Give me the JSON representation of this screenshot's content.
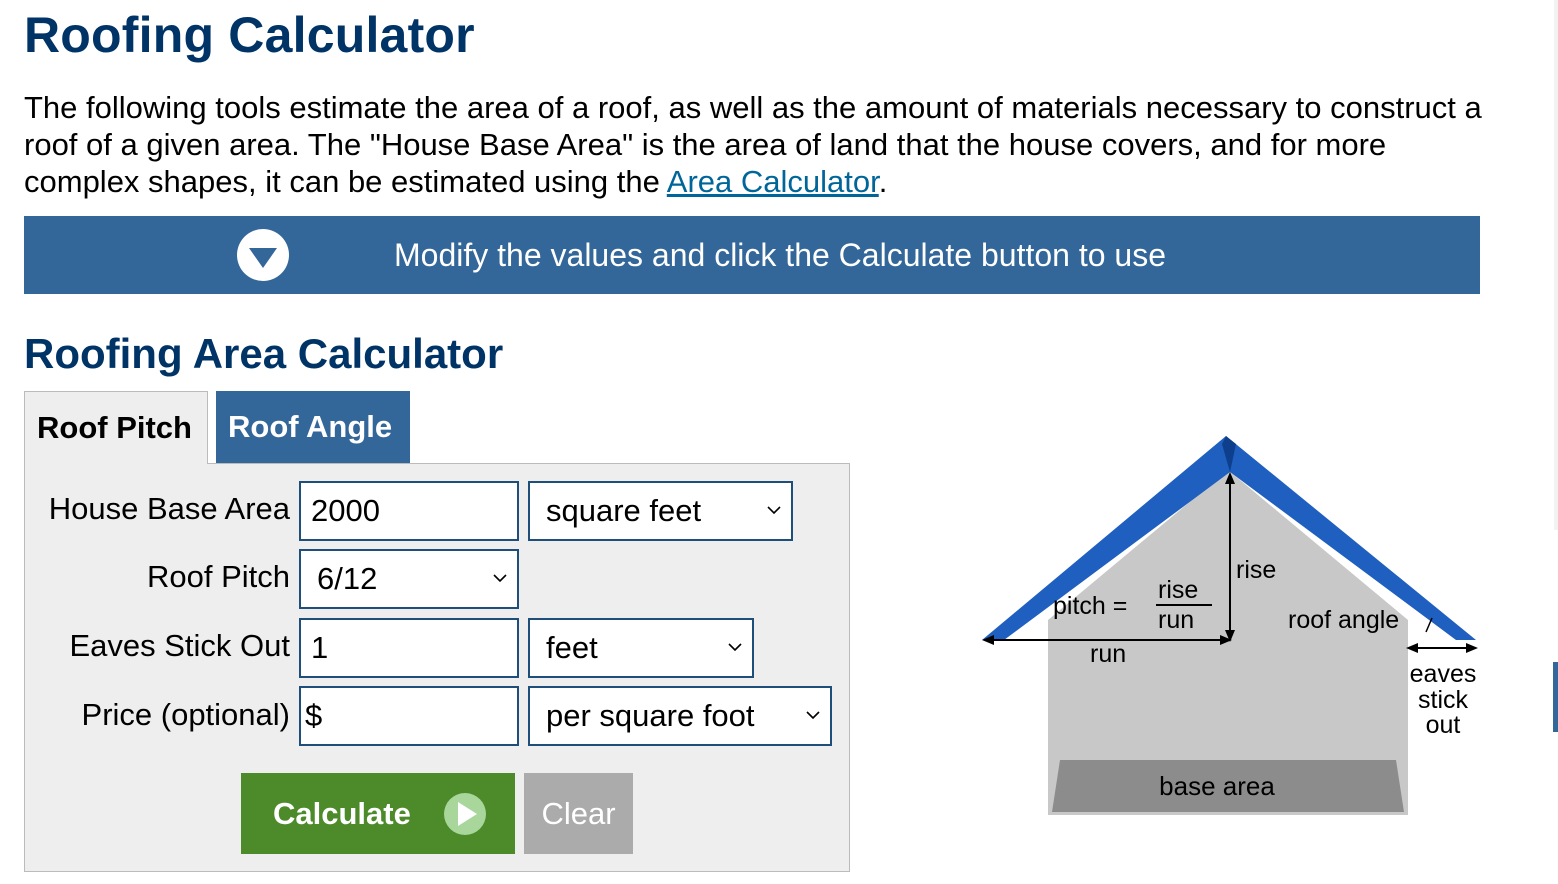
{
  "page": {
    "title": "Roofing Calculator",
    "intro_text": "The following tools estimate the area of a roof, as well as the amount of materials necessary to construct a roof of a given area. The \"House Base Area\" is the area of land that the house covers, and for more complex shapes, it can be estimated using the",
    "intro_link": "Area Calculator",
    "intro_end": "."
  },
  "banner": {
    "text": "Modify the values and click the Calculate button to use",
    "icon": "chevron-down-circle-icon"
  },
  "calculator": {
    "title": "Roofing Area Calculator",
    "tabs": [
      {
        "label": "Roof Pitch",
        "active": true
      },
      {
        "label": "Roof Angle",
        "active": false
      }
    ],
    "fields": {
      "base_area": {
        "label": "House Base Area",
        "value": "2000",
        "unit": "square feet"
      },
      "roof_pitch": {
        "label": "Roof Pitch",
        "value": "6/12"
      },
      "eaves": {
        "label": "Eaves Stick Out",
        "value": "1",
        "unit": "feet"
      },
      "price": {
        "label": "Price (optional)",
        "value": "$",
        "unit": "per square foot"
      }
    },
    "buttons": {
      "calculate": "Calculate",
      "clear": "Clear"
    }
  },
  "diagram": {
    "labels": {
      "rise": "rise",
      "pitch": "pitch =",
      "frac_rise": "rise",
      "frac_run": "run",
      "run": "run",
      "roof_angle": "roof angle",
      "eaves1": "eaves",
      "eaves2": "stick",
      "eaves3": "out",
      "base_area": "base area"
    }
  },
  "colors": {
    "title": "#003366",
    "banner": "#336699",
    "calculate": "#4c8a2a",
    "clear": "#ababab",
    "roof": "#1e5fbf",
    "wall": "#c8c8c8"
  }
}
